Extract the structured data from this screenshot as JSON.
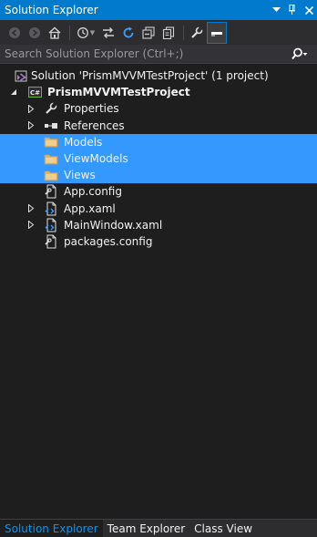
{
  "window": {
    "title": "Solution Explorer",
    "pin_icon": "pin-icon",
    "close_icon": "close-icon",
    "dropdown_icon": "dropdown-icon"
  },
  "toolbar": {
    "buttons": [
      "back",
      "forward",
      "home",
      "history",
      "sync",
      "refresh",
      "collapse-all",
      "show-all-files",
      "properties",
      "preview"
    ]
  },
  "search": {
    "placeholder": "Search Solution Explorer (Ctrl+;)",
    "value": ""
  },
  "tree": {
    "solution_label": "Solution 'PrismMVVMTestProject' (1 project)",
    "project_label": "PrismMVVMTestProject",
    "items": [
      {
        "label": "Properties",
        "icon": "wrench-icon",
        "expandable": true,
        "selected": false
      },
      {
        "label": "References",
        "icon": "references-icon",
        "expandable": true,
        "selected": false
      },
      {
        "label": "Models",
        "icon": "folder-icon",
        "expandable": false,
        "selected": true
      },
      {
        "label": "ViewModels",
        "icon": "folder-icon",
        "expandable": false,
        "selected": true
      },
      {
        "label": "Views",
        "icon": "folder-icon",
        "expandable": false,
        "selected": true
      },
      {
        "label": "App.config",
        "icon": "config-file-icon",
        "expandable": false,
        "selected": false
      },
      {
        "label": "App.xaml",
        "icon": "xaml-file-icon",
        "expandable": true,
        "selected": false
      },
      {
        "label": "MainWindow.xaml",
        "icon": "xaml-file-icon",
        "expandable": true,
        "selected": false
      },
      {
        "label": "packages.config",
        "icon": "config-file-icon",
        "expandable": false,
        "selected": false
      }
    ]
  },
  "bottom_tabs": [
    {
      "label": "Solution Explorer",
      "active": true
    },
    {
      "label": "Team Explorer",
      "active": false
    },
    {
      "label": "Class View",
      "active": false
    }
  ],
  "colors": {
    "accent": "#007acc",
    "selection": "#3399ff",
    "background": "#1e1e1e",
    "toolbar": "#2d2d30",
    "folder": "#dcb67a"
  }
}
